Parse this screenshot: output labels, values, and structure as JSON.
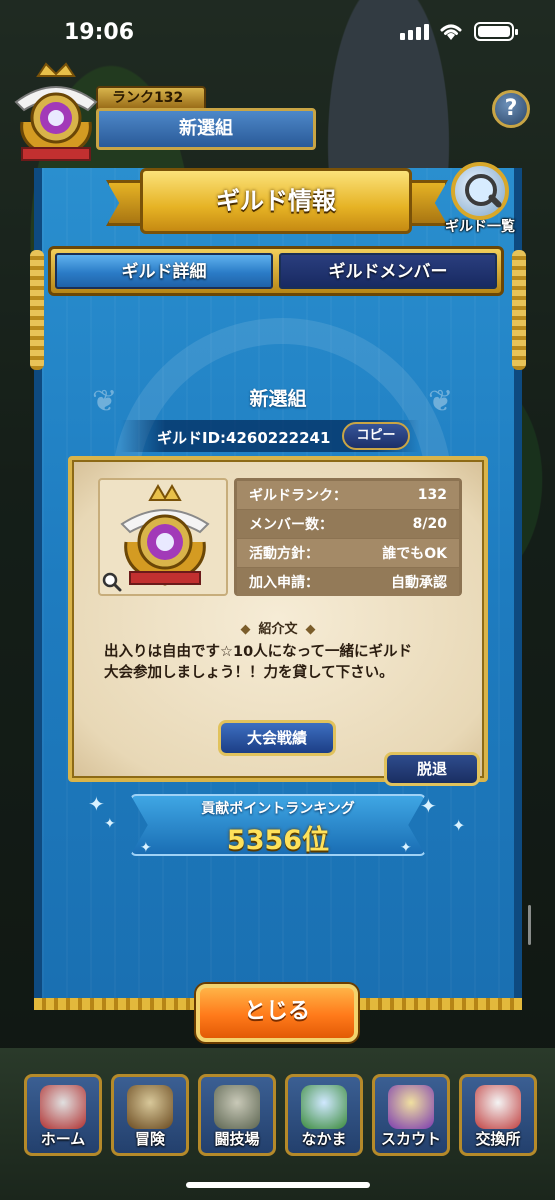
{
  "status_bar": {
    "time": "19:06"
  },
  "header": {
    "rank_label": "ランク132",
    "guild_name": "新選組",
    "help": "?"
  },
  "panel": {
    "title": "ギルド情報",
    "guild_list_label": "ギルド一覧",
    "tabs": [
      {
        "label": "ギルド詳細",
        "active": true
      },
      {
        "label": "ギルドメンバー",
        "active": false
      }
    ],
    "guild_name": "新選組",
    "guild_id": "ギルドID:4260222241",
    "copy_label": "コピー"
  },
  "info": {
    "rows": [
      {
        "key": "ギルドランク：",
        "value": "132"
      },
      {
        "key": "メンバー数：",
        "value": "8/20"
      },
      {
        "key": "活動方針：",
        "value": "誰でもOK"
      },
      {
        "key": "加入申請：",
        "value": "自動承認"
      }
    ],
    "intro_title": "紹介文",
    "intro_line1": "出入りは自由です☆10人になって一緒にギルド",
    "intro_line2": "大会参加しましょう！！力を貸して下さい。",
    "results_label": "大会戦績",
    "leave_label": "脱退"
  },
  "ranking": {
    "label": "貢献ポイントランキング",
    "value": "5356位"
  },
  "close_label": "とじる",
  "nav": [
    {
      "label": "ホーム",
      "icon": "home-tent-icon"
    },
    {
      "label": "冒険",
      "icon": "adventure-wagon-icon"
    },
    {
      "label": "闘技場",
      "icon": "arena-castle-icon"
    },
    {
      "label": "なかま",
      "icon": "party-monster-icon"
    },
    {
      "label": "スカウト",
      "icon": "scout-portal-icon"
    },
    {
      "label": "交換所",
      "icon": "exchange-creature-icon"
    }
  ],
  "colors": {
    "banner_blue": "#1e7cc0",
    "gold": "#e6b325",
    "parchment": "#f6ecd6",
    "close_orange": "#ff7a1a",
    "rank_yellow": "#ffe15a"
  }
}
